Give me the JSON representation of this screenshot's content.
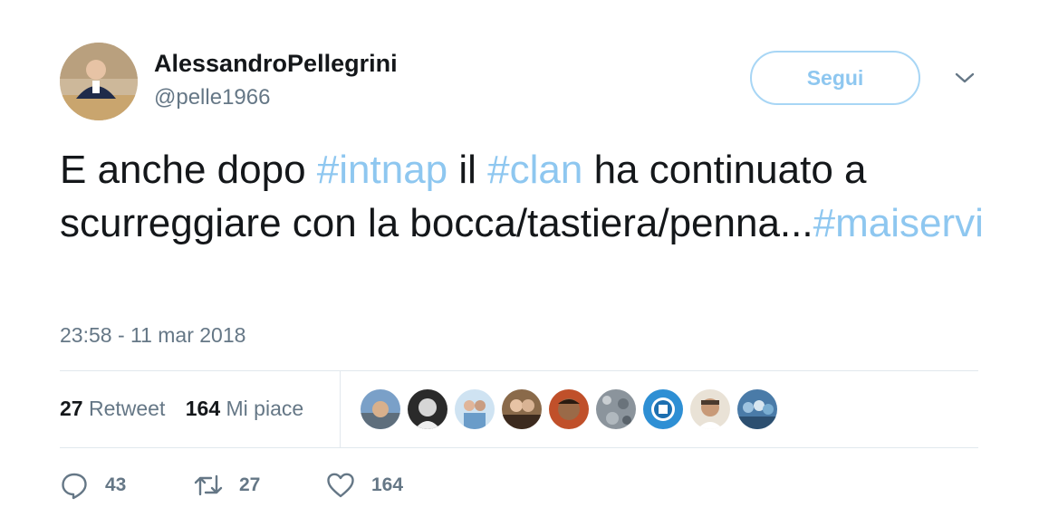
{
  "author": {
    "name": "AlessandroPellegrini",
    "handle": "@pelle1966"
  },
  "follow_label": "Segui",
  "tweet": {
    "parts": [
      {
        "text": "E anche dopo ",
        "hashtag": false
      },
      {
        "text": "#intnap",
        "hashtag": true
      },
      {
        "text": " il ",
        "hashtag": false
      },
      {
        "text": "#clan",
        "hashtag": true
      },
      {
        "text": " ha continuato a  scurreggiare con la bocca/tastiera/penna...",
        "hashtag": false
      },
      {
        "text": "#maiservi",
        "hashtag": true
      }
    ]
  },
  "timestamp": "23:58 - 11 mar 2018",
  "stats": {
    "retweets_count": "27",
    "retweets_label": "Retweet",
    "likes_count": "164",
    "likes_label": "Mi piace"
  },
  "likers_count_shown": 9,
  "actions": {
    "reply_count": "43",
    "retweet_count": "27",
    "like_count": "164"
  },
  "colors": {
    "hashtag": "#8ec7f0",
    "secondary_text": "#657786",
    "divider": "#e1e8ed",
    "follow_border": "#a8d6f5"
  },
  "icons": [
    "chevron-down-icon",
    "reply-icon",
    "retweet-icon",
    "heart-icon"
  ]
}
